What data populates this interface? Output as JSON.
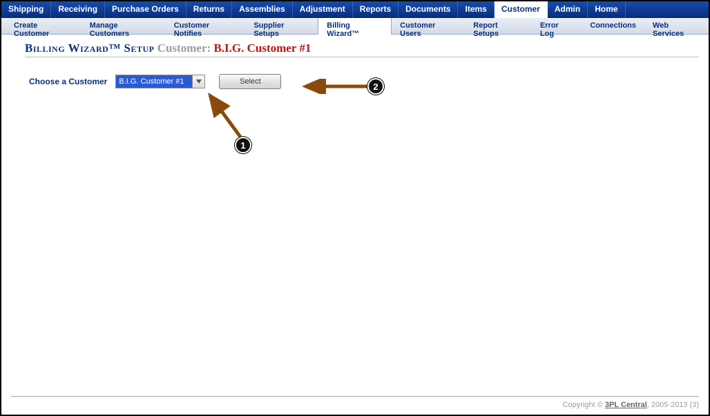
{
  "topnav": {
    "items": [
      "Shipping",
      "Receiving",
      "Purchase Orders",
      "Returns",
      "Assemblies",
      "Adjustment",
      "Reports",
      "Documents",
      "Items",
      "Customer",
      "Admin",
      "Home"
    ],
    "active_index": 9
  },
  "subnav": {
    "items": [
      "Create Customer",
      "Manage Customers",
      "Customer Notifies",
      "Supplier Setups",
      "Billing Wizard™",
      "Customer Users",
      "Report Setups",
      "Error Log",
      "Connections",
      "Web Services"
    ],
    "active_index": 4
  },
  "heading": {
    "title_a": "Billing Wizard™ Setup",
    "title_b": "Customer:",
    "title_c": "B.I.G. Customer #1"
  },
  "form": {
    "label": "Choose a Customer",
    "customer_value": "B.I.G. Customer #1",
    "select_button": "Select"
  },
  "annotations": {
    "marker1": "1",
    "marker2": "2"
  },
  "footer": {
    "copyright_prefix": "Copyright © ",
    "company": "3PL Central",
    "suffix": ", 2005-2013 (3)"
  }
}
